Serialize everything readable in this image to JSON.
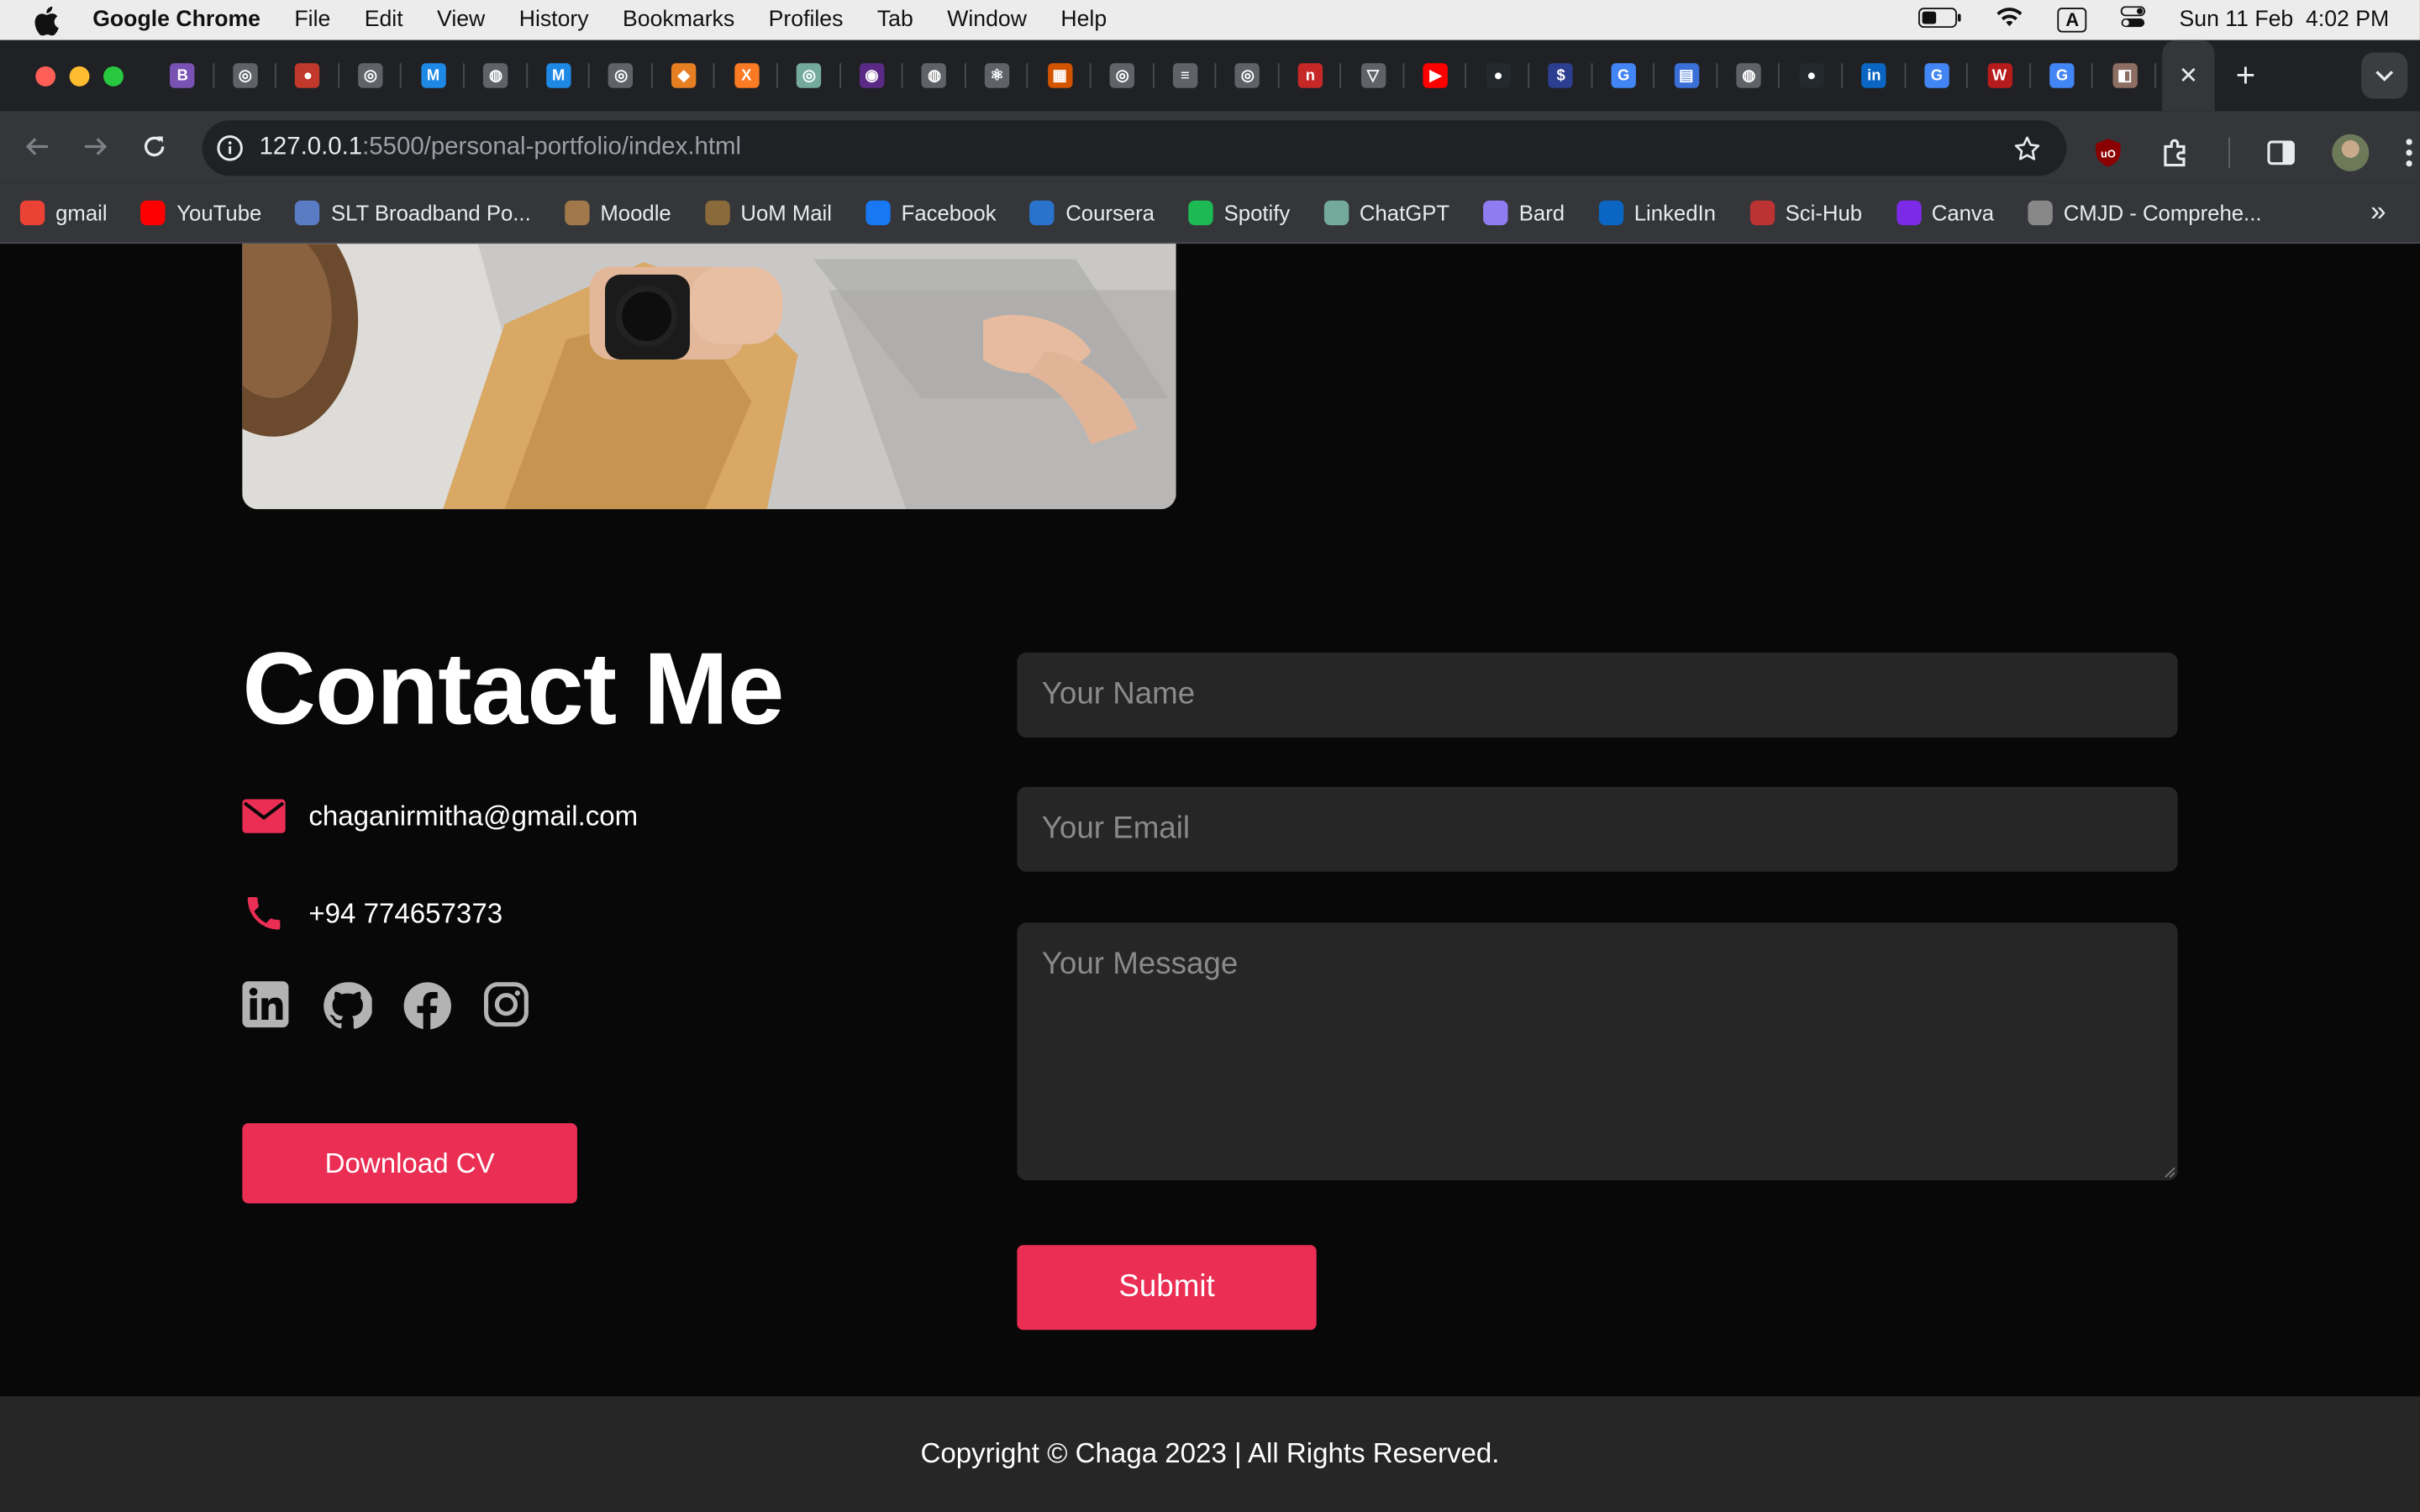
{
  "menubar": {
    "app_name": "Google Chrome",
    "items": [
      "File",
      "Edit",
      "View",
      "History",
      "Bookmarks",
      "Profiles",
      "Tab",
      "Window",
      "Help"
    ],
    "datetime": "Sun 11 Feb  4:02 PM",
    "input_indicator": "A"
  },
  "browser": {
    "url_host": "127.0.0.1",
    "url_rest": ":5500/personal-portfolio/index.html",
    "bookmarks": [
      {
        "label": "gmail",
        "icon": "gmail-icon",
        "color": "#ea4335"
      },
      {
        "label": "YouTube",
        "icon": "youtube-icon",
        "color": "#ff0000"
      },
      {
        "label": "SLT Broadband Po...",
        "icon": "slt-icon",
        "color": "#5a7cc4"
      },
      {
        "label": "Moodle",
        "icon": "moodle-icon",
        "color": "#a0784a"
      },
      {
        "label": "UoM Mail",
        "icon": "uom-icon",
        "color": "#8a6a3a"
      },
      {
        "label": "Facebook",
        "icon": "facebook-icon",
        "color": "#1877f2"
      },
      {
        "label": "Coursera",
        "icon": "coursera-icon",
        "color": "#2a73cc"
      },
      {
        "label": "Spotify",
        "icon": "spotify-icon",
        "color": "#1db954"
      },
      {
        "label": "ChatGPT",
        "icon": "chatgpt-icon",
        "color": "#74aa9c"
      },
      {
        "label": "Bard",
        "icon": "bard-icon",
        "color": "#8e7cf0"
      },
      {
        "label": "LinkedIn",
        "icon": "linkedin-icon",
        "color": "#0a66c2"
      },
      {
        "label": "Sci-Hub",
        "icon": "scihub-icon",
        "color": "#b33"
      },
      {
        "label": "Canva",
        "icon": "canva-icon",
        "color": "#7d2ae8"
      },
      {
        "label": "CMJD - Comprehe...",
        "icon": "cmjd-icon",
        "color": "#888"
      }
    ],
    "tabs": [
      {
        "icon": "bootstrap-icon",
        "color": "#7952b3",
        "glyph": "B"
      },
      {
        "icon": "github-copilot-icon",
        "color": "#5f6368",
        "glyph": "◎"
      },
      {
        "icon": "record-icon",
        "color": "#c0392b",
        "glyph": "●"
      },
      {
        "icon": "github-copilot-icon",
        "color": "#5f6368",
        "glyph": "◎"
      },
      {
        "icon": "mui-icon",
        "color": "#1e88e5",
        "glyph": "M"
      },
      {
        "icon": "globe-icon",
        "color": "#5f6368",
        "glyph": "◍"
      },
      {
        "icon": "mui-icon",
        "color": "#1e88e5",
        "glyph": "M"
      },
      {
        "icon": "github-copilot-icon",
        "color": "#5f6368",
        "glyph": "◎"
      },
      {
        "icon": "diamond-icon",
        "color": "#e67e22",
        "glyph": "◆"
      },
      {
        "icon": "xampp-icon",
        "color": "#fb7a24",
        "glyph": "X"
      },
      {
        "icon": "chatgpt-icon",
        "color": "#74aa9c",
        "glyph": "◎"
      },
      {
        "icon": "purple-icon",
        "color": "#5b2a86",
        "glyph": "◉"
      },
      {
        "icon": "globe-icon",
        "color": "#5f6368",
        "glyph": "◍"
      },
      {
        "icon": "react-icon",
        "color": "#5f6368",
        "glyph": "⚛"
      },
      {
        "icon": "image-icon",
        "color": "#d35400",
        "glyph": "▦"
      },
      {
        "icon": "settings-icon",
        "color": "#5f6368",
        "glyph": "◎"
      },
      {
        "icon": "list-icon",
        "color": "#5f6368",
        "glyph": "≡"
      },
      {
        "icon": "target-icon",
        "color": "#5f6368",
        "glyph": "◎"
      },
      {
        "icon": "netlify-icon",
        "color": "#c62828",
        "glyph": "n"
      },
      {
        "icon": "vercel-icon",
        "color": "#5f6368",
        "glyph": "▽"
      },
      {
        "icon": "youtube-icon",
        "color": "#ff0000",
        "glyph": "▶"
      },
      {
        "icon": "github-icon",
        "color": "#24292f",
        "glyph": "●"
      },
      {
        "icon": "dollar-icon",
        "color": "#2c3e8f",
        "glyph": "$"
      },
      {
        "icon": "google-icon",
        "color": "#4285f4",
        "glyph": "G"
      },
      {
        "icon": "chat-icon",
        "color": "#3a6fd8",
        "glyph": "▤"
      },
      {
        "icon": "globe-icon",
        "color": "#5f6368",
        "glyph": "◍"
      },
      {
        "icon": "github-icon",
        "color": "#24292f",
        "glyph": "●"
      },
      {
        "icon": "linkedin-icon",
        "color": "#0a66c2",
        "glyph": "in"
      },
      {
        "icon": "google-icon",
        "color": "#4285f4",
        "glyph": "G"
      },
      {
        "icon": "wsc-icon",
        "color": "#b71c1c",
        "glyph": "W"
      },
      {
        "icon": "google-icon",
        "color": "#4285f4",
        "glyph": "G"
      },
      {
        "icon": "portrait-icon",
        "color": "#8d6e63",
        "glyph": "◧"
      }
    ]
  },
  "contact": {
    "title": "Contact Me",
    "email": "chaganirmitha@gmail.com",
    "phone": "+94 774657373",
    "socials": [
      "linkedin-icon",
      "github-icon",
      "facebook-icon",
      "instagram-icon"
    ],
    "download_label": "Download CV",
    "form": {
      "name_placeholder": "Your Name",
      "email_placeholder": "Your Email",
      "message_placeholder": "Your Message",
      "submit_label": "Submit"
    }
  },
  "footer": {
    "text": "Copyright © Chaga 2023 | All Rights Reserved."
  },
  "colors": {
    "accent": "#ea2e54",
    "page_bg": "#080808",
    "field_bg": "#262626"
  }
}
